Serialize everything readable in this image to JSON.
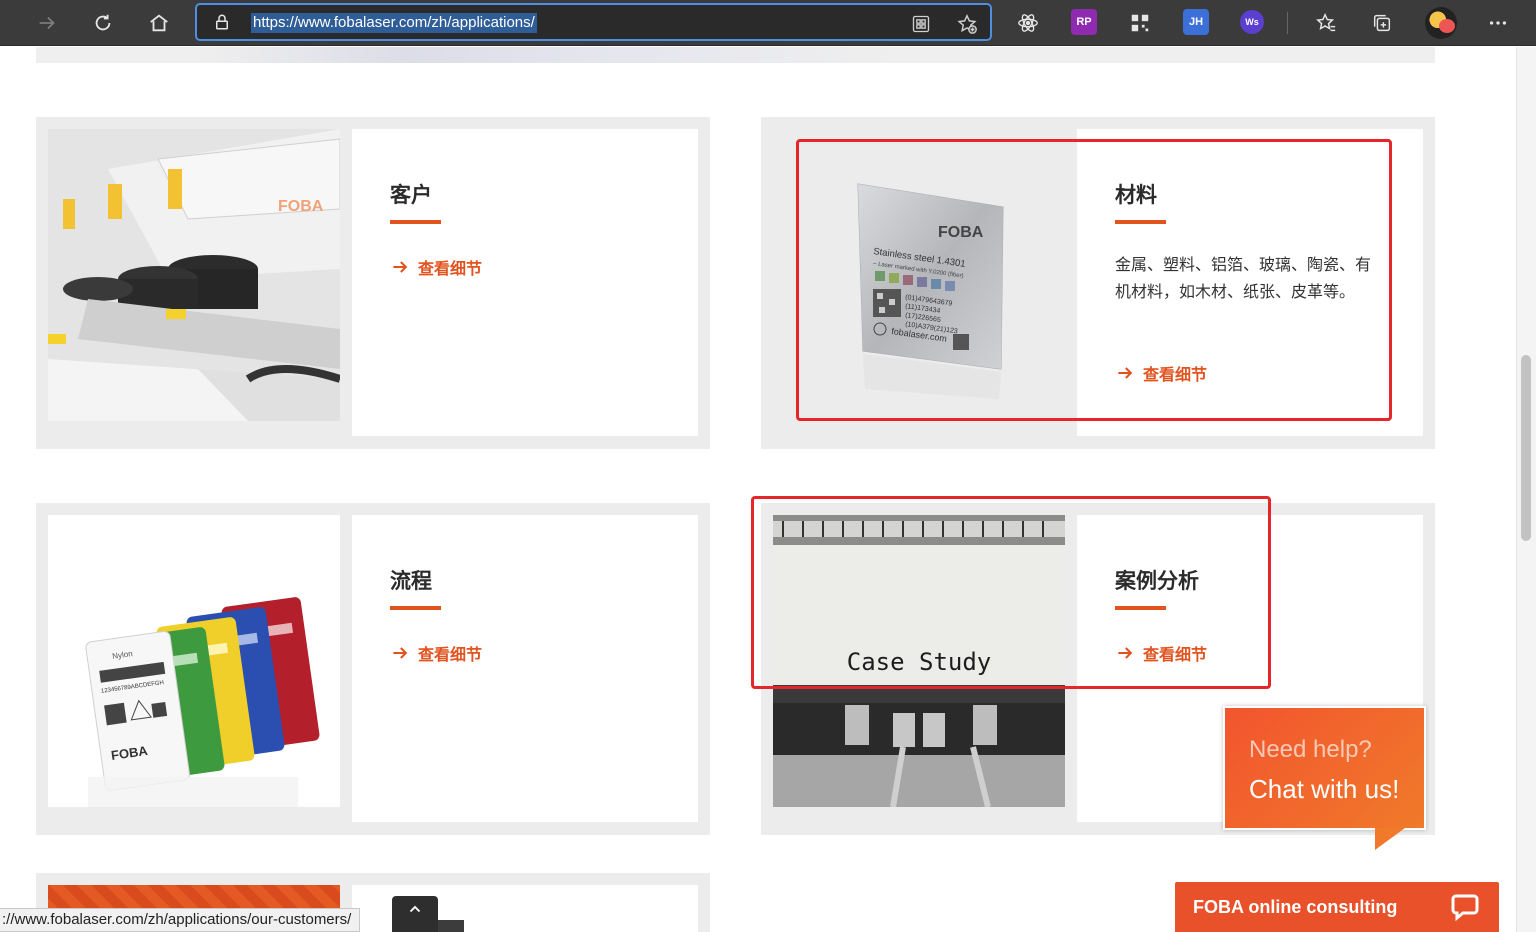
{
  "browser": {
    "url": "https://www.fobalaser.com/zh/applications/",
    "extensions": [
      {
        "name": "react-devtools-icon",
        "label": ""
      },
      {
        "name": "rp-extension-icon",
        "label": "RP",
        "color": "#8e2bb0"
      },
      {
        "name": "qr-code-icon",
        "label": ""
      },
      {
        "name": "jh-extension-icon",
        "label": "JH",
        "color": "#3d6fd8"
      },
      {
        "name": "ws-extension-icon",
        "label": "Ws",
        "color": "#5a3fd1"
      }
    ]
  },
  "cards": [
    {
      "id": "customers",
      "title": "客户",
      "description": "",
      "link_label": "查看细节",
      "image_icon": "laser-machine-image"
    },
    {
      "id": "materials",
      "title": "材料",
      "description": "金属、塑料、铝箔、玻璃、陶瓷、有机材料，如木材、纸张、皮革等。",
      "link_label": "查看细节",
      "image_icon": "stainless-steel-sample-image",
      "image_text": {
        "brand": "FOBA",
        "line1": "Stainless steel 1.4301",
        "line2": "– Laser marked with Y.0200 (fiber)",
        "codes": [
          "(01)479643679",
          "(11)173434",
          "(17)226565",
          "(10)A379(21)123"
        ],
        "site": "fobalaser.com"
      }
    },
    {
      "id": "process",
      "title": "流程",
      "description": "",
      "link_label": "查看细节",
      "image_icon": "nylon-tags-image",
      "image_text": {
        "brand": "FOBA",
        "tag": "Nylon",
        "code": "123456789ABCDEFGH"
      }
    },
    {
      "id": "case-study",
      "title": "案例分析",
      "description": "",
      "link_label": "查看细节",
      "image_icon": "typewriter-case-study-image",
      "image_text": {
        "caption": "Case Study"
      }
    }
  ],
  "chat": {
    "bubble_line1": "Need help?",
    "bubble_line2": "Chat with us!",
    "bar_label": "FOBA online consulting"
  },
  "status_url": "://www.fobalaser.com/zh/applications/our-customers/",
  "colors": {
    "accent": "#e2531f",
    "highlight_box": "#e5262a"
  }
}
